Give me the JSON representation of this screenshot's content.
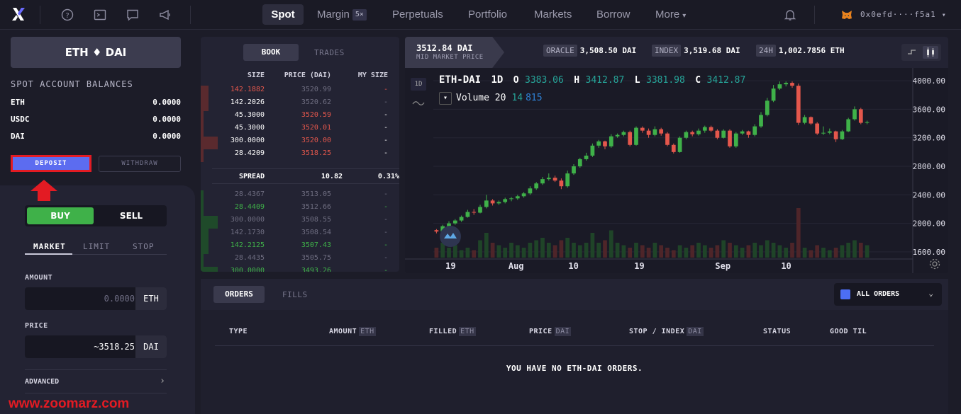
{
  "nav": {
    "tabs": [
      {
        "label": "Spot",
        "active": true
      },
      {
        "label": "Margin",
        "badge": "5×"
      },
      {
        "label": "Perpetuals"
      },
      {
        "label": "Portfolio"
      },
      {
        "label": "Markets"
      },
      {
        "label": "Borrow"
      },
      {
        "label": "More"
      }
    ],
    "wallet": "0x0efd····f5a1"
  },
  "market": {
    "pair": "ETH ♦ DAI",
    "balances_title": "SPOT ACCOUNT BALANCES",
    "balances": [
      {
        "asset": "ETH",
        "value": "0.0000"
      },
      {
        "asset": "USDC",
        "value": "0.0000"
      },
      {
        "asset": "DAI",
        "value": "0.0000"
      }
    ],
    "deposit_label": "DEPOSIT",
    "withdraw_label": "WITHDRAW"
  },
  "trade": {
    "buy_label": "BUY",
    "sell_label": "SELL",
    "order_types": [
      "MARKET",
      "LIMIT",
      "STOP"
    ],
    "amount_label": "AMOUNT",
    "amount_placeholder": "0.0000",
    "amount_unit": "ETH",
    "price_label": "PRICE",
    "price_value": "~3518.25",
    "price_unit": "DAI",
    "advanced_label": "ADVANCED"
  },
  "orderbook": {
    "tabs": [
      "BOOK",
      "TRADES"
    ],
    "headers": [
      "SIZE",
      "PRICE (DAI)",
      "MY SIZE"
    ],
    "asks": [
      {
        "size": "142.1882",
        "price": "3520.99",
        "my": "-",
        "dim": true
      },
      {
        "size": "142.2026",
        "price": "3520.62",
        "my": "-",
        "dim": true
      },
      {
        "size": "45.3000",
        "price": "3520.59",
        "my": "-"
      },
      {
        "size": "45.3000",
        "price": "3520.01",
        "my": "-"
      },
      {
        "size": "300.0000",
        "price": "3520.00",
        "my": "-"
      },
      {
        "size": "28.4209",
        "price": "3518.25",
        "my": "-"
      }
    ],
    "spread": {
      "label": "SPREAD",
      "value": "10.82",
      "pct": "0.31%"
    },
    "bids": [
      {
        "size": "28.4367",
        "price": "3513.05",
        "my": "-",
        "dim": true
      },
      {
        "size": "28.4409",
        "price": "3512.66",
        "my": "-",
        "dim": true
      },
      {
        "size": "300.0000",
        "price": "3508.55",
        "my": "-",
        "dim": true
      },
      {
        "size": "142.1730",
        "price": "3508.54",
        "my": "-",
        "dim": true
      },
      {
        "size": "142.2125",
        "price": "3507.43",
        "my": "-"
      },
      {
        "size": "28.4435",
        "price": "3505.75",
        "my": "-",
        "dim": true
      },
      {
        "size": "300.0000",
        "price": "3493.26",
        "my": "-"
      }
    ]
  },
  "chart_header": {
    "mid_price": "3512.84 DAI",
    "mid_label": "MID MARKET PRICE",
    "oracle_tag": "ORACLE",
    "oracle_value": "3,508.50 DAI",
    "index_tag": "INDEX",
    "index_value": "3,519.68 DAI",
    "h24_tag": "24H",
    "h24_value": "1,002.7856 ETH"
  },
  "chart_legend": {
    "symbol": "ETH-DAI",
    "interval": "1D",
    "o_label": "O",
    "o": "3383.06",
    "h_label": "H",
    "h": "3412.87",
    "l_label": "L",
    "l": "3381.98",
    "c_label": "C",
    "c": "3412.87",
    "volume_label": "Volume 20",
    "volume_a": "14",
    "volume_b": "815",
    "interval_button": "1D"
  },
  "chart_data": {
    "type": "candlestick",
    "symbol": "ETH-DAI",
    "ylim": [
      1500,
      4100
    ],
    "yticks": [
      "4000.00",
      "3600.00",
      "3200.00",
      "2800.00",
      "2400.00",
      "2000.00",
      "1600.00"
    ],
    "xticks": [
      "19",
      "Aug",
      "10",
      "19",
      "Sep",
      "10"
    ],
    "candles": [
      [
        1905,
        1885,
        1920,
        1860
      ],
      [
        1885,
        1960,
        1980,
        1870
      ],
      [
        1960,
        2000,
        2030,
        1940
      ],
      [
        2000,
        2040,
        2060,
        1980
      ],
      [
        2040,
        2090,
        2110,
        2020
      ],
      [
        2090,
        2160,
        2190,
        2080
      ],
      [
        2160,
        2150,
        2200,
        2120
      ],
      [
        2150,
        2230,
        2260,
        2140
      ],
      [
        2230,
        2320,
        2400,
        2210
      ],
      [
        2320,
        2280,
        2340,
        2250
      ],
      [
        2280,
        2300,
        2320,
        2260
      ],
      [
        2300,
        2340,
        2360,
        2280
      ],
      [
        2340,
        2350,
        2370,
        2310
      ],
      [
        2350,
        2380,
        2400,
        2330
      ],
      [
        2380,
        2420,
        2440,
        2360
      ],
      [
        2420,
        2490,
        2520,
        2400
      ],
      [
        2490,
        2560,
        2580,
        2470
      ],
      [
        2560,
        2620,
        2650,
        2540
      ],
      [
        2620,
        2640,
        2700,
        2600
      ],
      [
        2640,
        2600,
        2670,
        2580
      ],
      [
        2600,
        2520,
        2630,
        2480
      ],
      [
        2520,
        2700,
        2740,
        2500
      ],
      [
        2700,
        2800,
        2830,
        2680
      ],
      [
        2800,
        2900,
        2920,
        2780
      ],
      [
        2900,
        2950,
        2990,
        2880
      ],
      [
        2950,
        3090,
        3120,
        2930
      ],
      [
        3090,
        3150,
        3170,
        3060
      ],
      [
        3150,
        3080,
        3160,
        3040
      ],
      [
        3080,
        3220,
        3250,
        3060
      ],
      [
        3220,
        3240,
        3260,
        3200
      ],
      [
        3240,
        3280,
        3300,
        3220
      ],
      [
        3280,
        3100,
        3300,
        3080
      ],
      [
        3100,
        3340,
        3360,
        3090
      ],
      [
        3340,
        3300,
        3360,
        3270
      ],
      [
        3300,
        3240,
        3330,
        3200
      ],
      [
        3240,
        3320,
        3360,
        3220
      ],
      [
        3320,
        3260,
        3340,
        3230
      ],
      [
        3260,
        3100,
        3280,
        3080
      ],
      [
        3100,
        3000,
        3120,
        2980
      ],
      [
        3000,
        3200,
        3220,
        2990
      ],
      [
        3200,
        3280,
        3300,
        3180
      ],
      [
        3280,
        3250,
        3300,
        3220
      ],
      [
        3250,
        3300,
        3330,
        3230
      ],
      [
        3300,
        3350,
        3370,
        3270
      ],
      [
        3350,
        3300,
        3370,
        3280
      ],
      [
        3300,
        3200,
        3320,
        3180
      ],
      [
        3200,
        3300,
        3320,
        3190
      ],
      [
        3300,
        3080,
        3320,
        3060
      ],
      [
        3080,
        3260,
        3280,
        3060
      ],
      [
        3260,
        3290,
        3310,
        3240
      ],
      [
        3290,
        3240,
        3300,
        3200
      ],
      [
        3240,
        3360,
        3390,
        3220
      ],
      [
        3360,
        3520,
        3560,
        3340
      ],
      [
        3520,
        3720,
        3760,
        3500
      ],
      [
        3720,
        3890,
        3940,
        3700
      ],
      [
        3890,
        3950,
        3990,
        3870
      ],
      [
        3950,
        3970,
        3990,
        3920
      ],
      [
        3970,
        3930,
        3990,
        3900
      ],
      [
        3930,
        3410,
        3960,
        3380
      ],
      [
        3410,
        3490,
        3520,
        3390
      ],
      [
        3490,
        3400,
        3500,
        3380
      ],
      [
        3400,
        3260,
        3420,
        3240
      ],
      [
        3260,
        3270,
        3360,
        3240
      ],
      [
        3270,
        3290,
        3330,
        3250
      ],
      [
        3290,
        3180,
        3300,
        3140
      ],
      [
        3180,
        3290,
        3310,
        3170
      ],
      [
        3290,
        3460,
        3480,
        3280
      ],
      [
        3460,
        3600,
        3640,
        3440
      ],
      [
        3600,
        3410,
        3620,
        3390
      ],
      [
        3410,
        3420,
        3440,
        3390
      ]
    ],
    "volumes": [
      0.2,
      0.3,
      0.2,
      0.25,
      0.15,
      0.2,
      0.15,
      0.35,
      0.5,
      0.3,
      0.25,
      0.2,
      0.3,
      0.25,
      0.2,
      0.3,
      0.35,
      0.4,
      0.3,
      0.25,
      0.35,
      0.4,
      0.3,
      0.25,
      0.3,
      0.5,
      0.3,
      0.35,
      0.55,
      0.3,
      0.25,
      0.2,
      0.3,
      0.25,
      0.2,
      0.3,
      0.25,
      0.2,
      0.15,
      0.25,
      0.2,
      0.25,
      0.3,
      0.25,
      0.2,
      0.25,
      0.35,
      0.3,
      0.25,
      0.2,
      0.25,
      0.3,
      0.25,
      0.35,
      0.3,
      0.25,
      0.2,
      0.3,
      1.0,
      0.2,
      0.15,
      0.25,
      0.2,
      0.15,
      0.2,
      0.25,
      0.3,
      0.35,
      0.3,
      0.25
    ]
  },
  "orders": {
    "tabs": [
      "ORDERS",
      "FILLS"
    ],
    "filter_label": "ALL ORDERS",
    "headers": [
      {
        "label": "TYPE"
      },
      {
        "label": "AMOUNT",
        "unit": "ETH"
      },
      {
        "label": "FILLED",
        "unit": "ETH"
      },
      {
        "label": "PRICE",
        "unit": "DAI"
      },
      {
        "label": "STOP / INDEX",
        "unit": "DAI"
      },
      {
        "label": "STATUS"
      },
      {
        "label": "GOOD TIL"
      }
    ],
    "empty_message": "YOU HAVE NO ETH-DAI ORDERS."
  },
  "watermark": "www.zoomarz.com",
  "colors": {
    "green": "#3fb149",
    "red": "#e4574c",
    "accent": "#5c6cf0",
    "highlight": "#e31b23"
  }
}
